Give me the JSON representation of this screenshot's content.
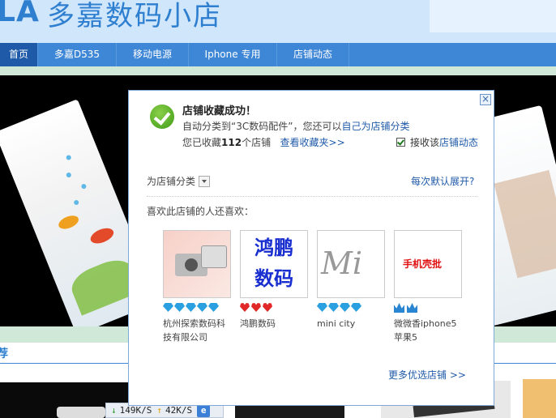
{
  "banner": {
    "logo": "LA",
    "shop_name": "多嘉数码小店"
  },
  "nav": {
    "items": [
      "首页",
      "多嘉D535",
      "移动电源",
      "Iphone 专用",
      "店铺动态"
    ]
  },
  "section_title": "荐",
  "status_bar": {
    "down": "149K/S",
    "up": "42K/S"
  },
  "dialog": {
    "title": "店铺收藏成功！",
    "line1_prefix": "自动分类到“3C数码配件”，您还可以",
    "line1_link": "自己为店铺分类",
    "line2_prefix": "您已收藏",
    "line2_count": "112",
    "line2_suffix": "个店铺",
    "view_link": "查看收藏夹>>",
    "receive_label": "接收该",
    "receive_link": "店铺动态",
    "category_label": "为店铺分类",
    "expand_link": "每次默认展开?",
    "like_label": "喜欢此店铺的人还喜欢：",
    "shops": [
      {
        "name": "杭州探索数码科技有限公司",
        "rank_type": "diamond",
        "rank_count": 5
      },
      {
        "name": "鸿鹏数码",
        "rank_type": "heart",
        "rank_count": 3,
        "pic_text": "鸿鹏\n数码"
      },
      {
        "name": "mini city",
        "rank_type": "diamond",
        "rank_count": 4,
        "pic_text": "Mi"
      },
      {
        "name": "微微香iphone5苹果5",
        "rank_type": "crown",
        "rank_count": 2,
        "pic_text": "手机壳批"
      }
    ],
    "more_link": "更多优选店铺 >>",
    "close_glyph": "×"
  }
}
